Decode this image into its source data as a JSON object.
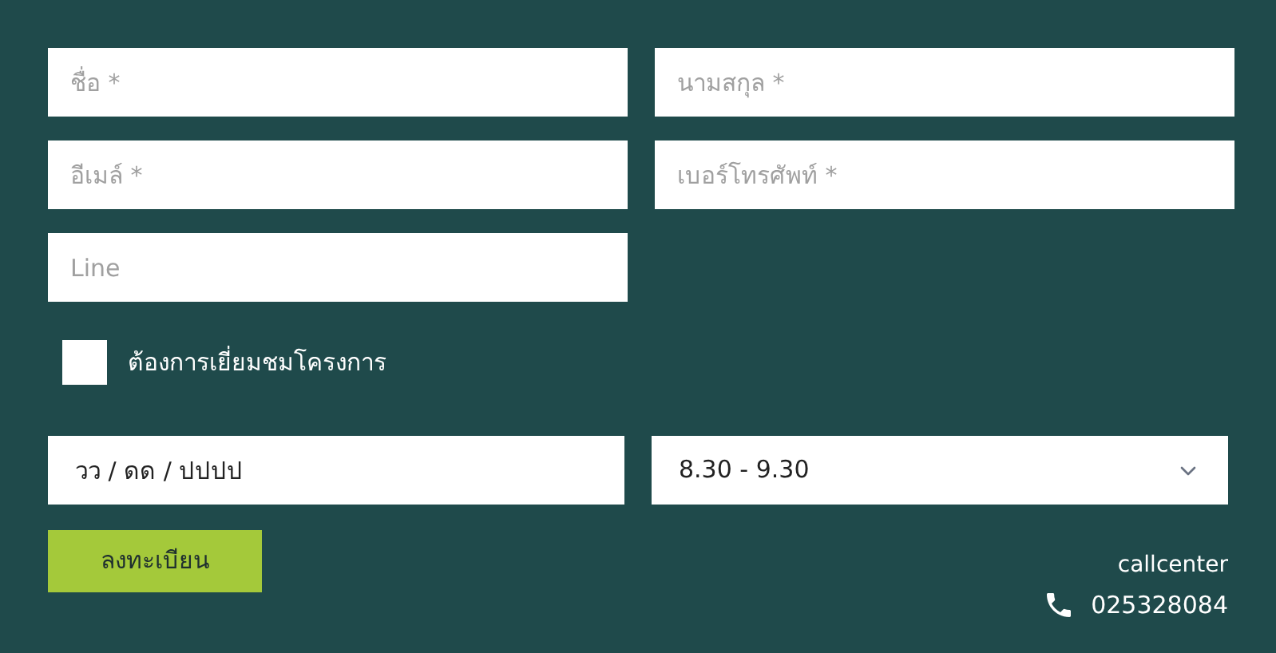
{
  "fields": [
    {
      "placeholder": "ชื่อ *"
    },
    {
      "placeholder": "นามสกุล *"
    },
    {
      "placeholder": "อีเมล์ *"
    },
    {
      "placeholder": "เบอร์โทรศัพท์ *"
    },
    {
      "placeholder": "Line"
    }
  ],
  "visit_checkbox": {
    "label": "ต้องการเยี่ยมชมโครงการ",
    "checked": false
  },
  "date_field": {
    "value": "วว / ดด / ปปปป"
  },
  "time_select": {
    "value": "8.30 - 9.30"
  },
  "submit_button": "ลงทะเบียน",
  "callcenter": {
    "label": "callcenter",
    "phone": "025328084"
  }
}
